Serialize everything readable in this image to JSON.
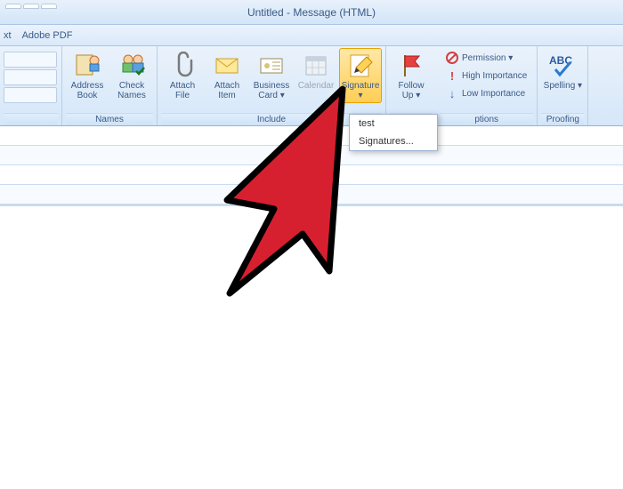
{
  "title": "Untitled - Message (HTML)",
  "menubar": {
    "item1": "xt",
    "item2": "Adobe PDF"
  },
  "groups": {
    "names": {
      "label": "Names",
      "address_book": "Address Book",
      "check_names": "Check Names"
    },
    "include": {
      "label": "Include",
      "attach_file": "Attach File",
      "attach_item": "Attach Item",
      "business_card": "Business Card",
      "calendar": "Calendar",
      "signature": "Signature"
    },
    "followup": {
      "follow_up": "Follow Up"
    },
    "options": {
      "label": "ptions",
      "permission": "Permission",
      "high_importance": "High Importance",
      "low_importance": "Low Importance"
    },
    "proofing": {
      "label": "Proofing",
      "spelling": "Spelling"
    }
  },
  "signature_menu": {
    "item1": "test",
    "item2": "Signatures..."
  },
  "browser_tabs": {
    "t1": "",
    "t2": "",
    "t3": ""
  }
}
